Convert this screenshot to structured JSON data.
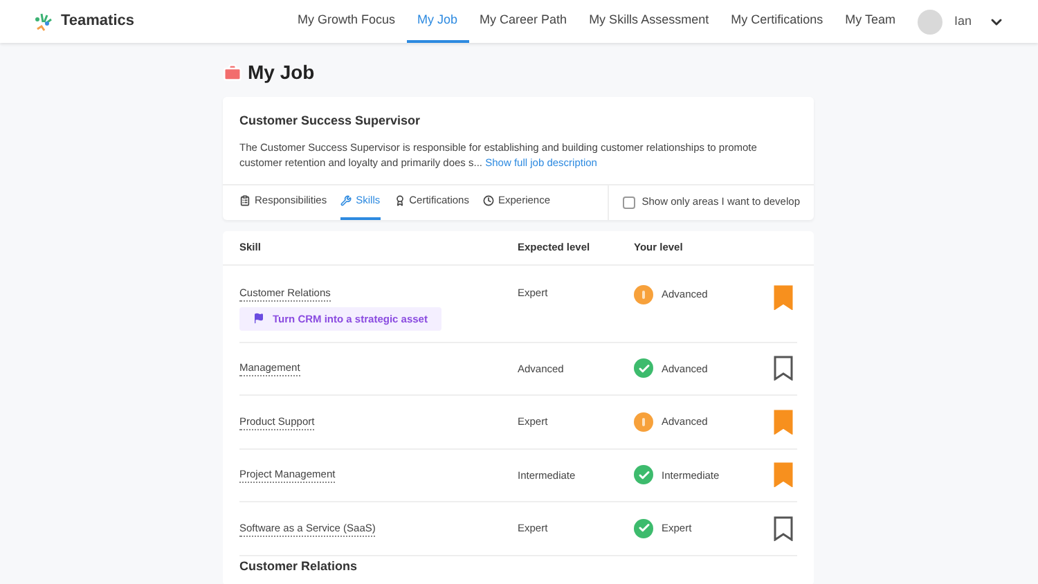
{
  "brand": {
    "name": "Teamatics"
  },
  "nav": [
    {
      "label": "My Growth Focus",
      "selected": false
    },
    {
      "label": "My Job",
      "selected": true
    },
    {
      "label": "My Career Path",
      "selected": false
    },
    {
      "label": "My Skills Assessment",
      "selected": false
    },
    {
      "label": "My Certifications",
      "selected": false
    },
    {
      "label": "My Team",
      "selected": false
    }
  ],
  "user": {
    "name": "Ian"
  },
  "page_title": "My Job",
  "job": {
    "title": "Customer Success Supervisor",
    "description": "The Customer Success Supervisor is responsible for establishing and building customer relationships to promote customer retention and loyalty and primarily does s...",
    "link": "Show full job description"
  },
  "tabs": [
    {
      "label": "Responsibilities",
      "kind": "clipboard",
      "selected": false
    },
    {
      "label": "Skills",
      "kind": "tools",
      "selected": true
    },
    {
      "label": "Certifications",
      "kind": "award",
      "selected": false
    },
    {
      "label": "Experience",
      "kind": "clock",
      "selected": false
    }
  ],
  "filter": {
    "label": "Show only areas I want to develop",
    "checked": false
  },
  "table": {
    "columns": [
      "Skill",
      "Expected level",
      "Your level"
    ],
    "rows": [
      {
        "skill": "Customer Relations",
        "expected": "Expert",
        "yours": "Advanced",
        "kind": "warning",
        "bookmarked": true,
        "goal": "Turn CRM into a strategic asset"
      },
      {
        "skill": "Management",
        "expected": "Advanced",
        "yours": "Advanced",
        "kind": "met",
        "bookmarked": false
      },
      {
        "skill": "Product Support",
        "expected": "Expert",
        "yours": "Advanced",
        "kind": "warning",
        "bookmarked": true
      },
      {
        "skill": "Project Management",
        "expected": "Intermediate",
        "yours": "Intermediate",
        "kind": "met",
        "bookmarked": true
      },
      {
        "skill": "Software as a Service (SaaS)",
        "expected": "Expert",
        "yours": "Expert",
        "kind": "met",
        "bookmarked": false
      }
    ]
  },
  "next_section": "Customer Relations"
}
